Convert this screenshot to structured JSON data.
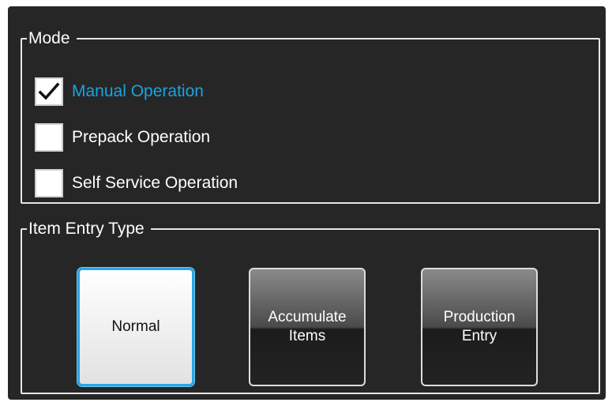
{
  "mode": {
    "legend": "Mode",
    "options": [
      {
        "label": "Manual Operation",
        "checked": true
      },
      {
        "label": "Prepack Operation",
        "checked": false
      },
      {
        "label": "Self Service Operation",
        "checked": false
      }
    ]
  },
  "item_entry": {
    "legend": "Item Entry Type",
    "buttons": [
      {
        "label": "Normal",
        "selected": true
      },
      {
        "label": "Accumulate Items",
        "selected": false
      },
      {
        "label": "Production Entry",
        "selected": false
      }
    ]
  },
  "colors": {
    "panel_bg": "#262626",
    "accent": "#1aa3e0",
    "text": "#ffffff"
  },
  "icons": {
    "check": "checkmark-icon"
  }
}
